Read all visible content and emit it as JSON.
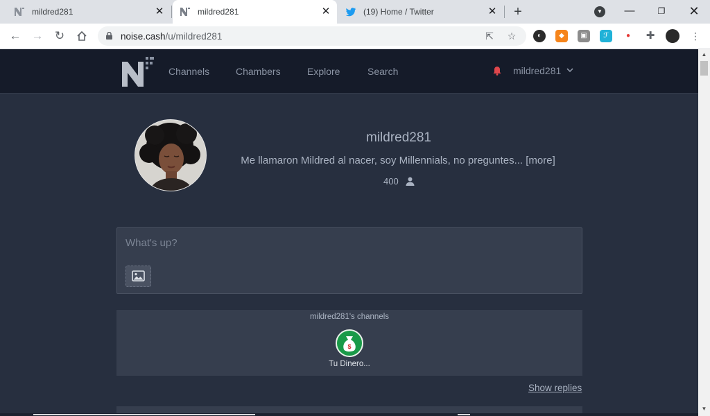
{
  "browser": {
    "tabs": [
      {
        "title": "mildred281",
        "icon": "noise-cash-favicon"
      },
      {
        "title": "mildred281",
        "icon": "noise-cash-favicon"
      },
      {
        "title": "(19) Home / Twitter",
        "icon": "twitter-icon"
      }
    ],
    "close_glyph": "✕",
    "new_tab_glyph": "+",
    "url_host": "noise.cash",
    "url_path": "/u/mildred281",
    "window_buttons": {
      "minimize": "—",
      "maximize": "❐",
      "close": "✕"
    }
  },
  "site_nav": {
    "links": [
      "Channels",
      "Chambers",
      "Explore",
      "Search"
    ],
    "username": "mildred281"
  },
  "profile": {
    "name": "mildred281",
    "bio": "Me llamaron Mildred al nacer, soy Millennials, no preguntes...",
    "more_label": "[more]",
    "followers": "400"
  },
  "composer": {
    "placeholder": "What's up?"
  },
  "channels": {
    "title": "mildred281's channels",
    "items": [
      {
        "label": "Tu Dinero...",
        "color": "#1a9a48"
      }
    ]
  },
  "show_replies_label": "Show replies",
  "colors": {
    "page_bg": "#272f3f",
    "nav_bg": "#151b29",
    "card_bg": "#363e4e",
    "bell": "#e0474c",
    "text": "#aab3c2"
  }
}
